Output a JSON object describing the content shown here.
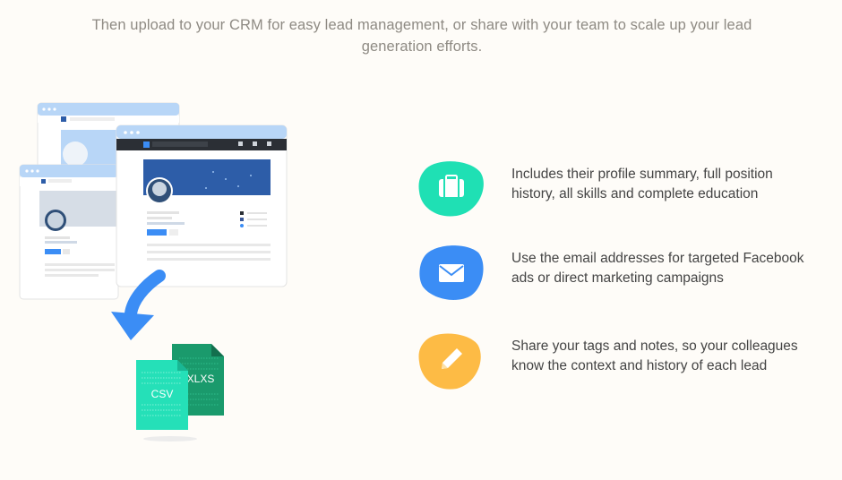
{
  "intro": {
    "line1": "Then upload to your CRM for easy lead management, or share with your team to scale up your lead",
    "line2": "generation efforts."
  },
  "illustration": {
    "csv_label": "CSV",
    "xlxs_label": "XLXS"
  },
  "features": [
    {
      "icon": "briefcase-icon",
      "color": "#1fe0b4",
      "line1": "Includes their profile summary, full position",
      "line2": "history, all skills and complete education"
    },
    {
      "icon": "envelope-icon",
      "color": "#3b8df5",
      "line1": "Use the email addresses for targeted Facebook",
      "line2": "ads or direct marketing campaigns"
    },
    {
      "icon": "pencil-icon",
      "color": "#fdbb45",
      "line1": "Share your tags and notes, so your colleagues",
      "line2": "know the context and history of each lead"
    }
  ],
  "colors": {
    "background": "#fefcf8",
    "browser_chrome": "#b8d6f7",
    "profile_banner": "#2d5da8",
    "arrow": "#3b8df5",
    "csv": "#25e0b8",
    "xlxs": "#1a9a6c"
  }
}
